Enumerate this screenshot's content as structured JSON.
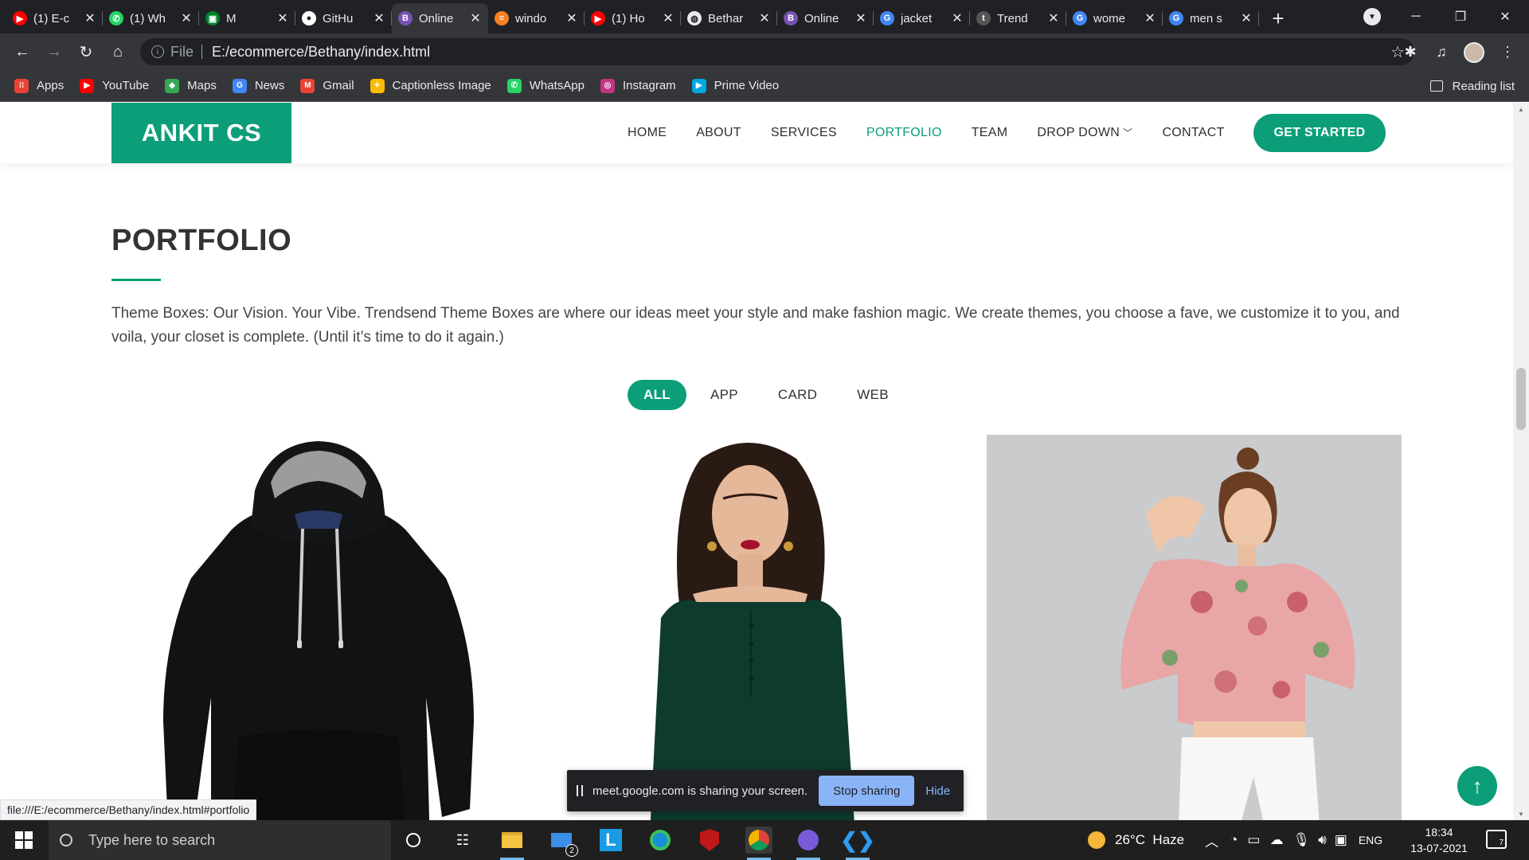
{
  "browser": {
    "tabs": [
      {
        "title": "(1) E-c",
        "icon": "youtube-icon",
        "color": "#ff0000"
      },
      {
        "title": "(1) Wh",
        "icon": "whatsapp-icon",
        "color": "#25d366"
      },
      {
        "title": "M",
        "icon": "meet-icon",
        "color": "#00832d"
      },
      {
        "title": "GitHu",
        "icon": "github-icon",
        "color": "#ffffff"
      },
      {
        "title": "Online",
        "icon": "bootstrap-icon",
        "color": "#7952b3",
        "active": true
      },
      {
        "title": "windo",
        "icon": "stackoverflow-icon",
        "color": "#f48024"
      },
      {
        "title": "(1) Ho",
        "icon": "youtube-icon",
        "color": "#ff0000"
      },
      {
        "title": "Bethar",
        "icon": "globe-icon",
        "color": "#e8eaed"
      },
      {
        "title": "Online",
        "icon": "bootstrap-icon",
        "color": "#7952b3"
      },
      {
        "title": "jacket",
        "icon": "google-icon",
        "color": "#4285f4"
      },
      {
        "title": "Trend",
        "icon": "trendsend-icon",
        "color": "#555555"
      },
      {
        "title": "wome",
        "icon": "google-icon",
        "color": "#4285f4"
      },
      {
        "title": "men s",
        "icon": "google-icon",
        "color": "#4285f4"
      }
    ],
    "url_scheme": "File",
    "url": "E:/ecommerce/Bethany/index.html",
    "bookmarks": [
      {
        "label": "Apps",
        "icon": "apps-grid-icon",
        "color": "#ea4335"
      },
      {
        "label": "YouTube",
        "icon": "youtube-icon",
        "color": "#ff0000"
      },
      {
        "label": "Maps",
        "icon": "maps-pin-icon",
        "color": "#34a853"
      },
      {
        "label": "News",
        "icon": "news-icon",
        "color": "#4285f4"
      },
      {
        "label": "Gmail",
        "icon": "gmail-icon",
        "color": "#ea4335"
      },
      {
        "label": "Captionless Image",
        "icon": "pinwheel-icon",
        "color": "#fbbc05"
      },
      {
        "label": "WhatsApp",
        "icon": "whatsapp-icon",
        "color": "#25d366"
      },
      {
        "label": "Instagram",
        "icon": "instagram-icon",
        "color": "#c13584"
      },
      {
        "label": "Prime Video",
        "icon": "prime-video-icon",
        "color": "#00a8e1"
      }
    ],
    "reading_list": "Reading list"
  },
  "site": {
    "logo": "ANKIT CS",
    "nav": {
      "home": "HOME",
      "about": "ABOUT",
      "services": "SERVICES",
      "portfolio": "PORTFOLIO",
      "team": "TEAM",
      "dropdown": "DROP DOWN",
      "contact": "CONTACT"
    },
    "cta": "GET STARTED",
    "accent": "#0b9e78"
  },
  "portfolio": {
    "title": "PORTFOLIO",
    "description": "Theme Boxes: Our Vision. Your Vibe. Trendsend Theme Boxes are where our ideas meet your style and make fashion magic. We create themes, you choose a fave, we customize it to you, and voila, your closet is complete. (Until it’s time to do it again.)",
    "filters": {
      "all": "ALL",
      "app": "APP",
      "card": "CARD",
      "web": "WEB"
    },
    "items": [
      {
        "name": "black-hoodie-image"
      },
      {
        "name": "woman-green-dress-image"
      },
      {
        "name": "floral-top-image"
      }
    ]
  },
  "overlays": {
    "share_message": "meet.google.com is sharing your screen.",
    "stop_sharing": "Stop sharing",
    "hide": "Hide",
    "status_url": "file:///E:/ecommerce/Bethany/index.html#portfolio"
  },
  "taskbar": {
    "search_placeholder": "Type here to search",
    "weather": "26°C  Haze",
    "language": "ENG",
    "time": "18:34",
    "date": "13-07-2021",
    "mail_badge": "2",
    "notification_count": "7"
  }
}
